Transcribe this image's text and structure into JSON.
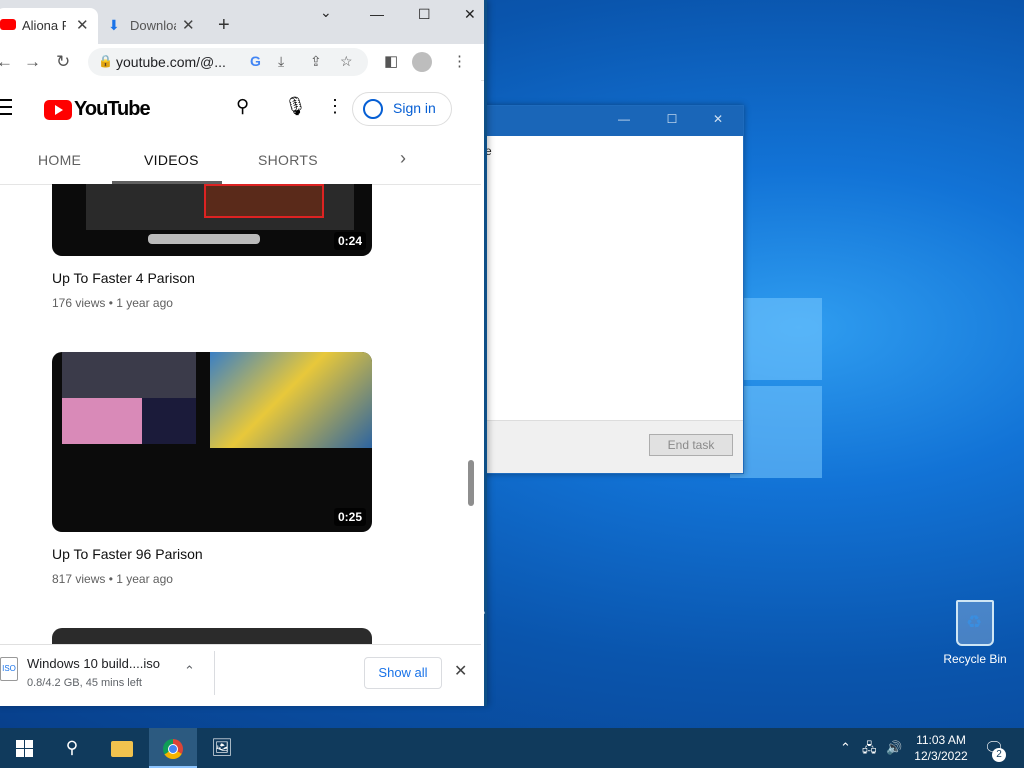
{
  "browser": {
    "tabs": [
      {
        "label": "Aliona F",
        "active": true
      },
      {
        "label": "Downloa",
        "active": false
      }
    ],
    "new_tab_label": "+",
    "url": "youtube.com/@...",
    "window_controls": {
      "minimize": "—",
      "maximize": "☐",
      "close": "✕",
      "tab_menu": "⌄"
    }
  },
  "youtube": {
    "logo_text": "YouTube",
    "sign_in": "Sign in",
    "tabs": [
      "HOME",
      "VIDEOS",
      "SHORTS"
    ],
    "active_tab": "VIDEOS",
    "videos": [
      {
        "title": "Up To Faster 4 Parison",
        "views": "176 views",
        "age": "1 year ago",
        "duration": "0:24"
      },
      {
        "title": "Up To Faster 96 Parison",
        "views": "817 views",
        "age": "1 year ago",
        "duration": "0:25"
      }
    ]
  },
  "download_shelf": {
    "file_name": "Windows 10 build....iso",
    "file_icon_text": "ISO",
    "status": "0.8/4.2 GB, 45 mins left",
    "show_all": "Show all"
  },
  "dialog": {
    "end_task": "End task",
    "partial_text": "e"
  },
  "desktop": {
    "recycle_bin_label": "Recycle Bin"
  },
  "taskbar": {
    "time": "11:03 AM",
    "date": "12/3/2022",
    "notification_count": "2"
  }
}
